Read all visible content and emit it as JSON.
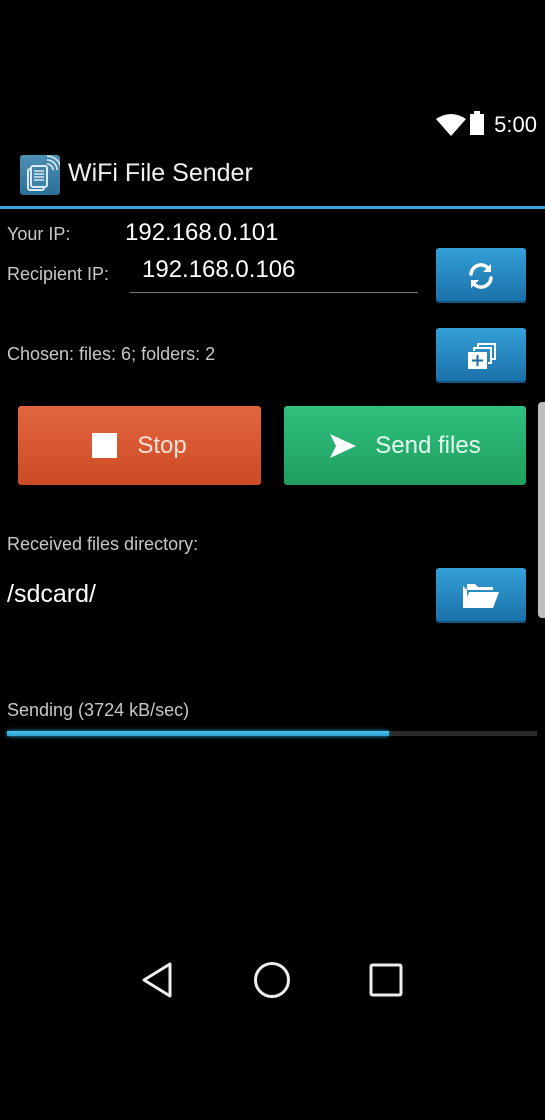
{
  "status_bar": {
    "time": "5:00",
    "icons": [
      "wifi-icon",
      "battery-icon"
    ]
  },
  "app_bar": {
    "title": "WiFi File Sender",
    "icon": "wifi-file-sender-app-icon"
  },
  "network": {
    "your_ip_label": "Your IP:",
    "your_ip_value": "192.168.0.101",
    "recipient_ip_label": "Recipient IP:",
    "recipient_ip_value": "192.168.0.106",
    "refresh_icon": "refresh-icon"
  },
  "selection": {
    "chosen_text": "Chosen: files: 6; folders: 2",
    "add_icon": "add-files-icon"
  },
  "actions": {
    "stop_label": "Stop",
    "stop_icon": "stop-icon",
    "send_label": "Send files",
    "send_icon": "send-icon"
  },
  "received": {
    "label": "Received files directory:",
    "path": "/sdcard/",
    "folder_icon": "folder-open-icon"
  },
  "progress": {
    "status_text": "Sending (3724 kB/sec)",
    "percent": 72
  },
  "colors": {
    "accent_blue": "#3aa5d8",
    "stop_red": "#d9552f",
    "send_green": "#27b06f"
  },
  "nav_bar": {
    "items": [
      "back",
      "home",
      "recents"
    ]
  }
}
